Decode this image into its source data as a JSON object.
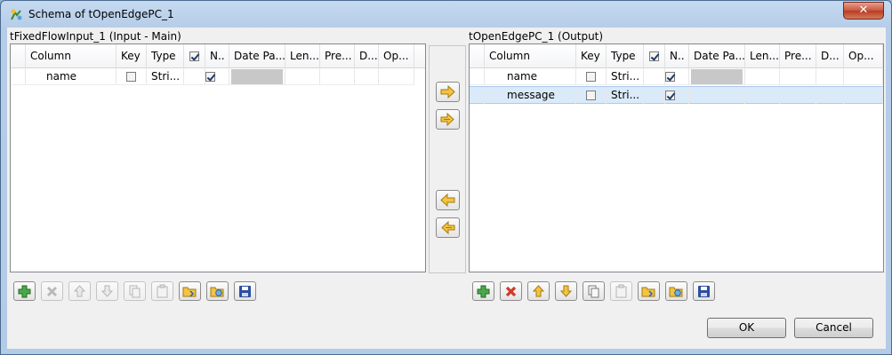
{
  "window": {
    "title": "Schema of tOpenEdgePC_1",
    "close_glyph": "✕"
  },
  "input_panel": {
    "label": "tFixedFlowInput_1 (Input - Main)",
    "columns": [
      "Column",
      "Key",
      "Type",
      "",
      "N..",
      "Date Pa...",
      "Len...",
      "Pre...",
      "D...",
      "Op..."
    ],
    "rows": [
      {
        "column": "name",
        "key": false,
        "type": "Stri...",
        "nullable": true
      }
    ]
  },
  "output_panel": {
    "label": "tOpenEdgePC_1 (Output)",
    "columns": [
      "Column",
      "Key",
      "Type",
      "",
      "N..",
      "Date Pa...",
      "Len...",
      "Pre...",
      "D...",
      "Op..."
    ],
    "rows": [
      {
        "column": "name",
        "key": false,
        "type": "Stri...",
        "nullable": true
      },
      {
        "column": "message",
        "key": false,
        "type": "Stri...",
        "nullable": true,
        "selected": true
      }
    ]
  },
  "transfer_buttons": [
    "copy-selected-right-icon",
    "copy-all-right-icon",
    "copy-selected-left-icon",
    "copy-all-left-icon"
  ],
  "toolbar_icons": [
    "add-icon",
    "delete-icon",
    "move-up-icon",
    "move-down-icon",
    "copy-icon",
    "paste-icon",
    "import-icon",
    "export-icon",
    "save-icon"
  ],
  "buttons": {
    "ok": "OK",
    "cancel": "Cancel"
  },
  "colors": {
    "accent": "#3c9a3c",
    "delete": "#d03a2a",
    "arrow": "#e8b22a",
    "save": "#2a4fa0"
  }
}
